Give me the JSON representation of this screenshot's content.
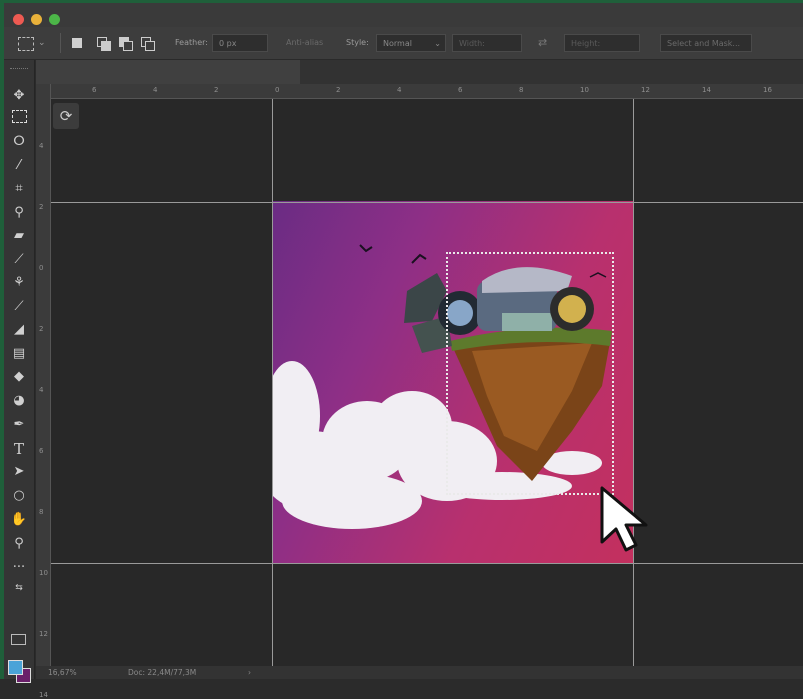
{
  "options_bar": {
    "feather_label": "Feather:",
    "feather_value": "0 px",
    "anti_alias_label": "Anti-alias",
    "style_label": "Style:",
    "style_value": "Normal",
    "width_placeholder": "Width:",
    "height_placeholder": "Height:",
    "select_and_mask_label": "Select and Mask..."
  },
  "status_bar": {
    "zoom": "16,67%",
    "doc_size": "Doc: 22,4M/77,3M"
  },
  "ruler_top": {
    "labels": [
      "6",
      "4",
      "2",
      "0",
      "2",
      "4",
      "6",
      "8",
      "10",
      "12",
      "14",
      "16"
    ]
  },
  "ruler_left": {
    "labels": [
      "4",
      "2",
      "0",
      "2",
      "4",
      "6",
      "8",
      "10",
      "12",
      "14"
    ]
  },
  "colors": {
    "foreground": "#4aa3d8",
    "background": "#6a1f6a",
    "artboard_gradient_start": "#6a2c84",
    "artboard_gradient_end": "#c3305e"
  },
  "tools": [
    "move-icon",
    "marquee-icon",
    "lasso-icon",
    "magic-wand-icon",
    "crop-icon",
    "eyedropper-icon",
    "healing-brush-icon",
    "brush-icon",
    "clone-stamp-icon",
    "history-brush-icon",
    "eraser-icon",
    "gradient-icon",
    "blur-icon",
    "dodge-icon",
    "pen-icon",
    "type-icon",
    "path-selection-icon",
    "shape-icon",
    "hand-icon",
    "zoom-icon",
    "more-tools-icon"
  ]
}
